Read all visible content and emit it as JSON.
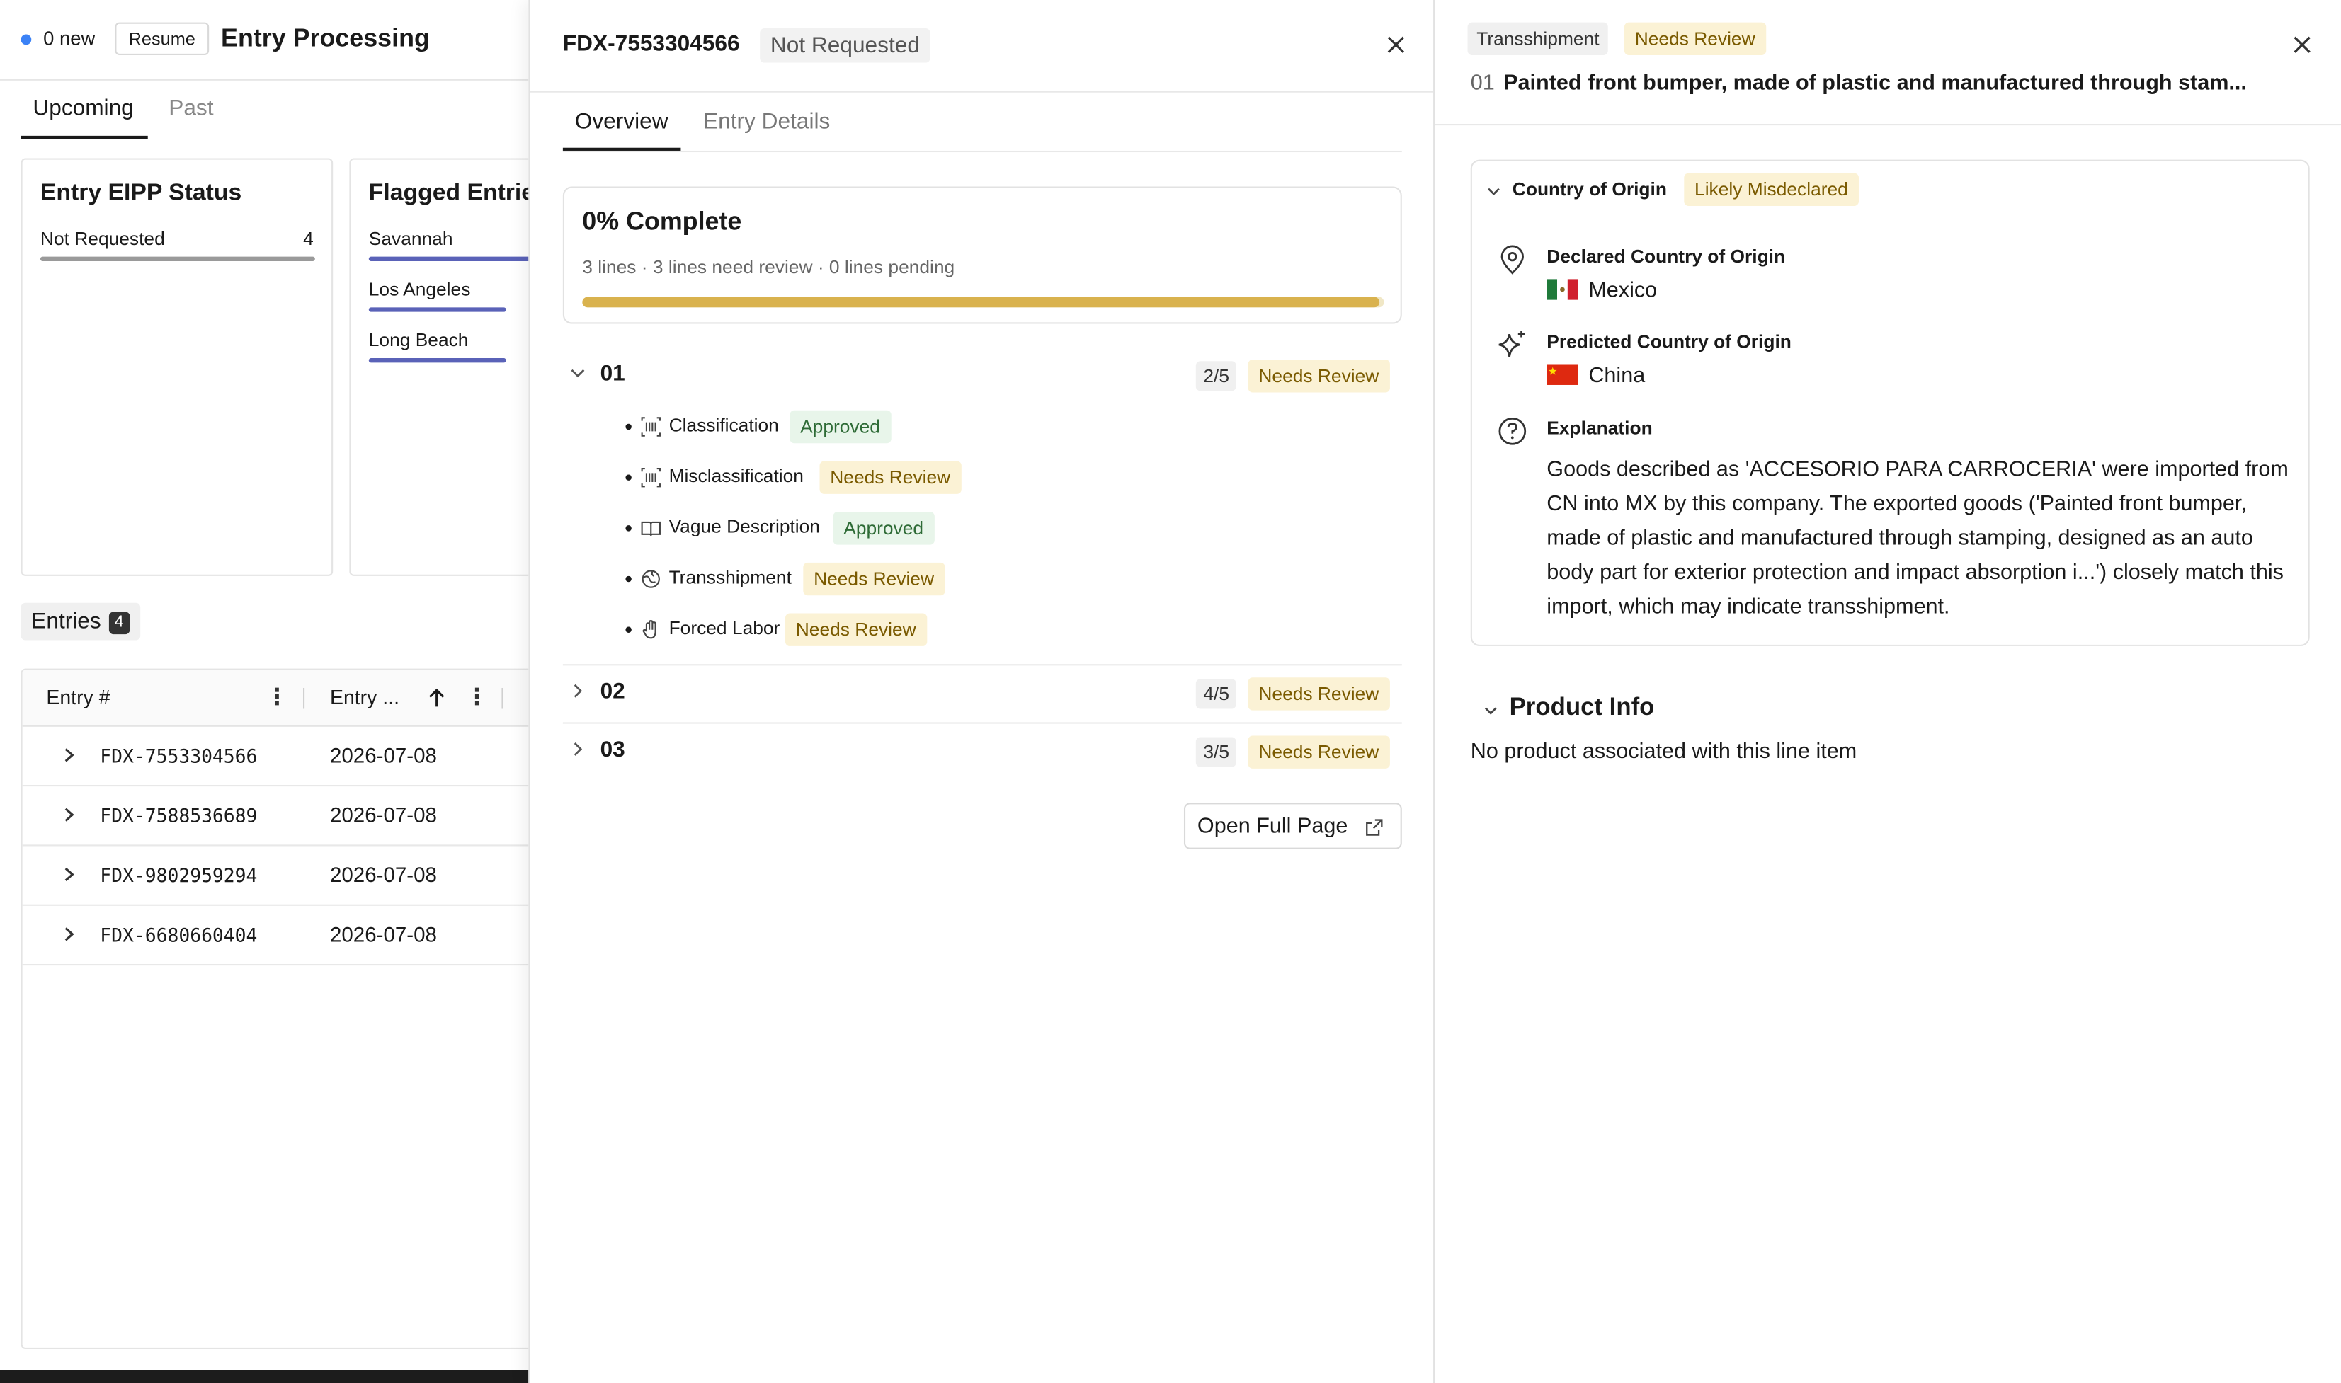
{
  "left": {
    "new_count": "0 new",
    "resume_label": "Resume",
    "title": "Entry Processing",
    "tabs": {
      "upcoming": "Upcoming",
      "past": "Past"
    },
    "eipp_card": {
      "title": "Entry EIPP Status",
      "rows": [
        {
          "label": "Not Requested",
          "count": "4"
        }
      ]
    },
    "flagged_card": {
      "title": "Flagged Entries",
      "rows": [
        {
          "label": "Savannah"
        },
        {
          "label": "Los Angeles"
        },
        {
          "label": "Long Beach"
        }
      ]
    },
    "entries_label": "Entries",
    "entries_count": "4",
    "table": {
      "col_entry": "Entry #",
      "col_date": "Entry ...",
      "rows": [
        {
          "entry": "FDX-7553304566",
          "date": "2026-07-08"
        },
        {
          "entry": "FDX-7588536689",
          "date": "2026-07-08"
        },
        {
          "entry": "FDX-9802959294",
          "date": "2026-07-08"
        },
        {
          "entry": "FDX-6680660404",
          "date": "2026-07-08"
        }
      ]
    }
  },
  "mid": {
    "entry_id": "FDX-7553304566",
    "status": "Not Requested",
    "tabs": {
      "overview": "Overview",
      "details": "Entry Details"
    },
    "progress": {
      "title": "0% Complete",
      "summary": "3 lines · 3 lines need review · 0 lines pending",
      "fill_fraction": 0.995
    },
    "lines": [
      {
        "num": "01",
        "count": "2/5",
        "status": "Needs Review",
        "checks": [
          {
            "icon": "barcode-icon",
            "label": "Classification",
            "status": "Approved"
          },
          {
            "icon": "barcode-icon",
            "label": "Misclassification",
            "status": "Needs Review"
          },
          {
            "icon": "book-icon",
            "label": "Vague Description",
            "status": "Approved"
          },
          {
            "icon": "globe-icon",
            "label": "Transshipment",
            "status": "Needs Review"
          },
          {
            "icon": "hand-icon",
            "label": "Forced Labor",
            "status": "Needs Review"
          }
        ]
      },
      {
        "num": "02",
        "count": "4/5",
        "status": "Needs Review"
      },
      {
        "num": "03",
        "count": "3/5",
        "status": "Needs Review"
      }
    ],
    "open_full": "Open Full Page"
  },
  "right": {
    "tags": {
      "check": "Transshipment",
      "status": "Needs Review"
    },
    "line_num": "01",
    "line_title": "Painted front bumper, made of plastic and manufactured through stam...",
    "coo": {
      "heading": "Country of Origin",
      "badge": "Likely Misdeclared",
      "declared_label": "Declared Country of Origin",
      "declared_value": "Mexico",
      "predicted_label": "Predicted Country of Origin",
      "predicted_value": "China",
      "explanation_label": "Explanation",
      "explanation": "Goods described as 'ACCESORIO PARA CARROCERIA' were imported from CN into MX by this company. The exported goods ('Painted front bumper, made of plastic and manufactured through stamping, designed as an auto body part for exterior protection and impact absorption i...') closely match this import, which may indicate transshipment."
    },
    "product_info": {
      "title": "Product Info",
      "empty": "No product associated with this line item"
    }
  },
  "colors": {
    "accent_blue": "#3b82f6",
    "progress_gold": "#d9b24e",
    "needs_review_bg": "#fbf2d5",
    "needs_review_fg": "#7a5a00",
    "approved_bg": "#e8f5ea",
    "approved_fg": "#2e6b36",
    "bar_indigo": "#5a62b8"
  }
}
